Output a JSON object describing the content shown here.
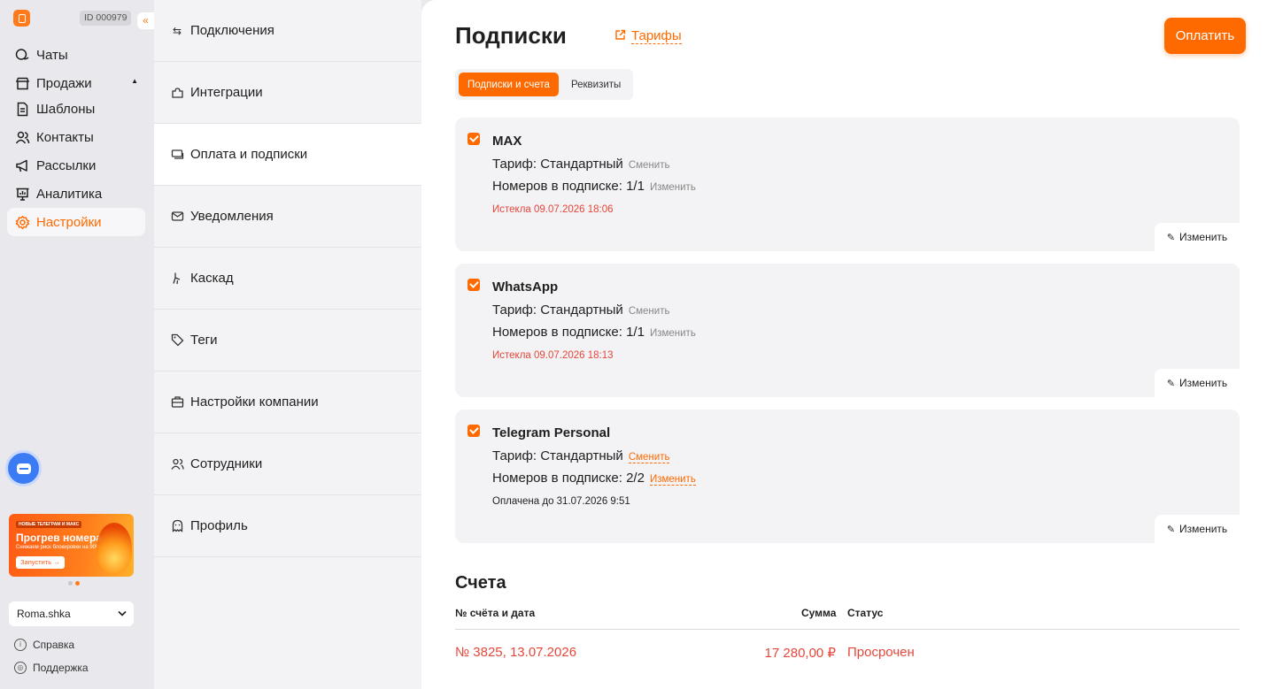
{
  "app": {
    "account_id": "ID 000979"
  },
  "sidebar": {
    "items": [
      {
        "label": "Чаты",
        "icon": "chats-icon"
      },
      {
        "label": "Продажи",
        "icon": "store-icon"
      },
      {
        "label": "Шаблоны",
        "icon": "document-icon"
      },
      {
        "label": "Контакты",
        "icon": "contacts-icon"
      },
      {
        "label": "Рассылки",
        "icon": "megaphone-icon"
      },
      {
        "label": "Аналитика",
        "icon": "analytics-icon"
      },
      {
        "label": "Настройки",
        "icon": "gear-icon",
        "active": true
      }
    ],
    "promo": {
      "tag": "НОВЫЕ ТЕЛЕГРАМ И МАКС",
      "title": "Прогрев номера",
      "subtitle": "Снижаем риск блокировки на 90%",
      "cta": "Запустить →"
    },
    "account_name": "Roma.shka",
    "help_label": "Справка",
    "support_label": "Поддержка"
  },
  "settings_menu": [
    {
      "label": "Подключения",
      "icon": "arrows-icon"
    },
    {
      "label": "Интеграции",
      "icon": "puzzle-icon"
    },
    {
      "label": "Оплата и подписки",
      "icon": "payment-icon",
      "active": true
    },
    {
      "label": "Уведомления",
      "icon": "mail-icon"
    },
    {
      "label": "Каскад",
      "icon": "cascade-icon"
    },
    {
      "label": "Теги",
      "icon": "tag-icon"
    },
    {
      "label": "Настройки компании",
      "icon": "briefcase-icon"
    },
    {
      "label": "Сотрудники",
      "icon": "users-icon"
    },
    {
      "label": "Профиль",
      "icon": "ghost-icon"
    }
  ],
  "main": {
    "title": "Подписки",
    "tariffs_link": "Тарифы",
    "pay_button": "Оплатить",
    "tabs": [
      {
        "label": "Подписки и счета",
        "active": true
      },
      {
        "label": "Реквизиты"
      }
    ],
    "subscriptions": [
      {
        "name": "MAX",
        "tariff_label": "Тариф: Стандартный",
        "tariff_action": "Сменить",
        "numbers_label": "Номеров в подписке: 1/1",
        "numbers_action": "Изменить",
        "status": "Истекла 09.07.2026 18:06",
        "edit_label": "Изменить"
      },
      {
        "name": "WhatsApp",
        "tariff_label": "Тариф: Стандартный",
        "tariff_action": "Сменить",
        "numbers_label": "Номеров в подписке: 1/1",
        "numbers_action": "Изменить",
        "status": "Истекла 09.07.2026 18:13",
        "edit_label": "Изменить"
      },
      {
        "name": "Telegram Personal",
        "tariff_label": "Тариф: Стандартный",
        "tariff_action": "Сменить",
        "numbers_label": "Номеров в подписке: 2/2",
        "numbers_action": "Изменить",
        "status": "Оплачена до 31.07.2026 9:51",
        "edit_label": "Изменить"
      }
    ],
    "bills": {
      "title": "Счета",
      "columns": [
        "№ счёта и дата",
        "Сумма",
        "Статус"
      ],
      "rows": [
        {
          "number_date": "№ 3825, 13.07.2026",
          "amount": "17 280,00 ₽",
          "status": "Просрочен"
        }
      ]
    }
  },
  "colors": {
    "accent": "#ff6a00",
    "error": "#e5473b",
    "chat_button": "#3b7cf5"
  }
}
